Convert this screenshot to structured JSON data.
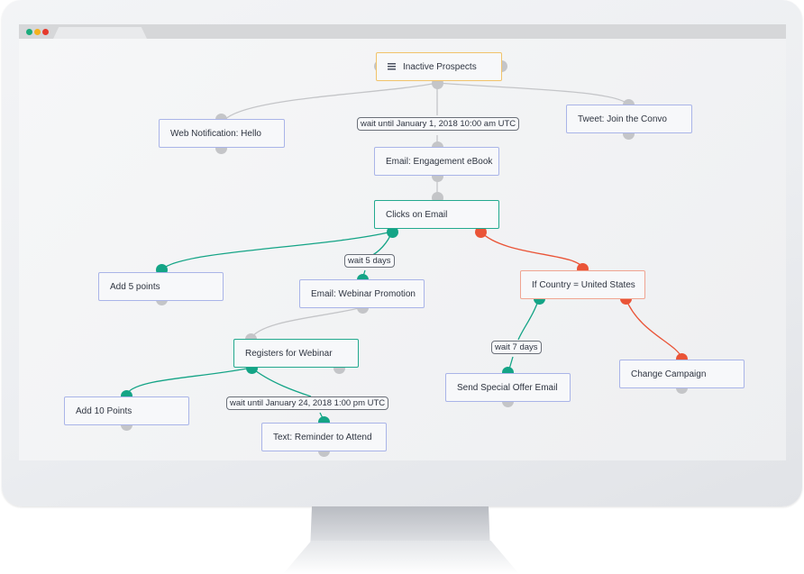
{
  "window": {
    "controls": [
      {
        "name": "green-dot",
        "color": "#1aab7c"
      },
      {
        "name": "yellow-dot",
        "color": "#f4b11d"
      },
      {
        "name": "red-dot",
        "color": "#e5392c"
      }
    ]
  },
  "colors": {
    "action_border": "#a9b4e8",
    "trigger_border": "#22a98e",
    "condition_border": "#f0a491",
    "root_border": "#f1c36a",
    "yes_path": "#14a486",
    "no_path": "#ea5437",
    "neutral_path": "#c4c5c8"
  },
  "flow": {
    "root": {
      "label": "Inactive Prospects",
      "icon": "list-icon"
    },
    "nodes": {
      "web_notification": "Web Notification: Hello",
      "tweet": "Tweet: Join the Convo",
      "email_ebook": "Email: Engagement eBook",
      "clicks_email": "Clicks on Email",
      "add_5": "Add 5 points",
      "email_webinar": "Email: Webinar Promotion",
      "if_country": "If Country = United States",
      "registers": "Registers for Webinar",
      "add_10": "Add 10 Points",
      "text_reminder": "Text: Reminder to Attend",
      "special_offer": "Send Special Offer Email",
      "change_campaign": "Change Campaign"
    },
    "waits": {
      "wait_jan1": "wait until January 1, 2018 10:00 am UTC",
      "wait_5": "wait 5 days",
      "wait_7": "wait 7 days",
      "wait_jan24": "wait until January 24, 2018 1:00 pm UTC"
    }
  }
}
